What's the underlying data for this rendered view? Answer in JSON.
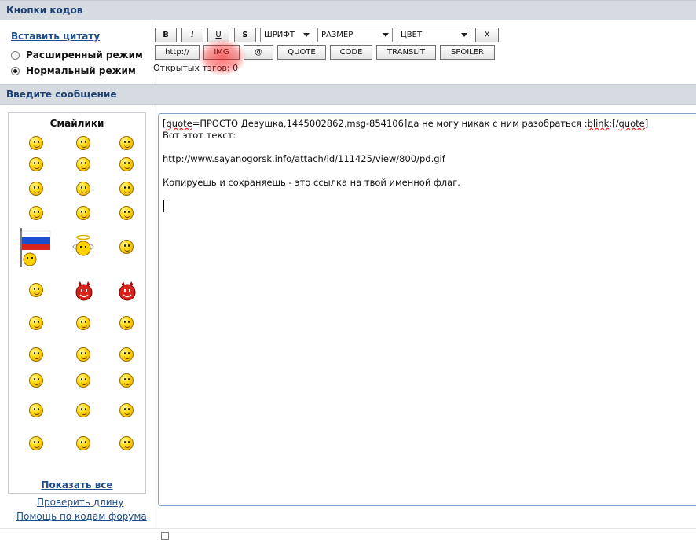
{
  "sections": {
    "code_buttons_title": "Кнопки кодов",
    "message_title": "Введите сообщение"
  },
  "left_panel": {
    "insert_quote": "Вставить цитату",
    "modes": [
      {
        "label": "Расширенный режим",
        "selected": false
      },
      {
        "label": "Нормальный режим",
        "selected": true
      }
    ]
  },
  "toolbar": {
    "bold": "B",
    "italic": "I",
    "underline": "U",
    "strike": "S",
    "font_select": "ШРИФТ",
    "size_select": "РАЗМЕР",
    "color_select": "ЦВЕТ",
    "close": "X",
    "http": "http://",
    "img": "IMG",
    "at": "@",
    "quote": "QUOTE",
    "code": "CODE",
    "translit": "TRANSLIT",
    "spoiler": "SPOILER",
    "open_tags": "Открытых тэгов: 0"
  },
  "smilies": {
    "title": "Смайлики",
    "show_all": "Показать все"
  },
  "links": {
    "check_length": "Проверить длину",
    "forum_help": "Помощь по кодам форума"
  },
  "editor": {
    "line1_pre": "[",
    "line1_quote": "quote",
    "line1_mid": "=ПРОСТО Девушка,1445002862,msg-854106]да не могу никак с ним разобраться :",
    "line1_blink": "blink",
    "line1_close_pre": ":[/",
    "line1_close_quote": "quote",
    "line1_end": "]",
    "line2": "Вот этот текст:",
    "line3": "http://www.sayanogorsk.info/attach/id/111425/view/800/pd.gif",
    "line4": "Копируешь и сохраняешь - это ссылка на твой именной флаг."
  },
  "colors": {
    "section_bg": "#d6dbe2",
    "section_text": "#1c3f73",
    "link": "#1f4e8a",
    "editor_border": "#7fa3c8",
    "highlight": "#ff0000"
  },
  "icons": [
    "smiley-icon",
    "flag-icon",
    "devil-icon",
    "angel-icon",
    "chevron-down-icon"
  ]
}
